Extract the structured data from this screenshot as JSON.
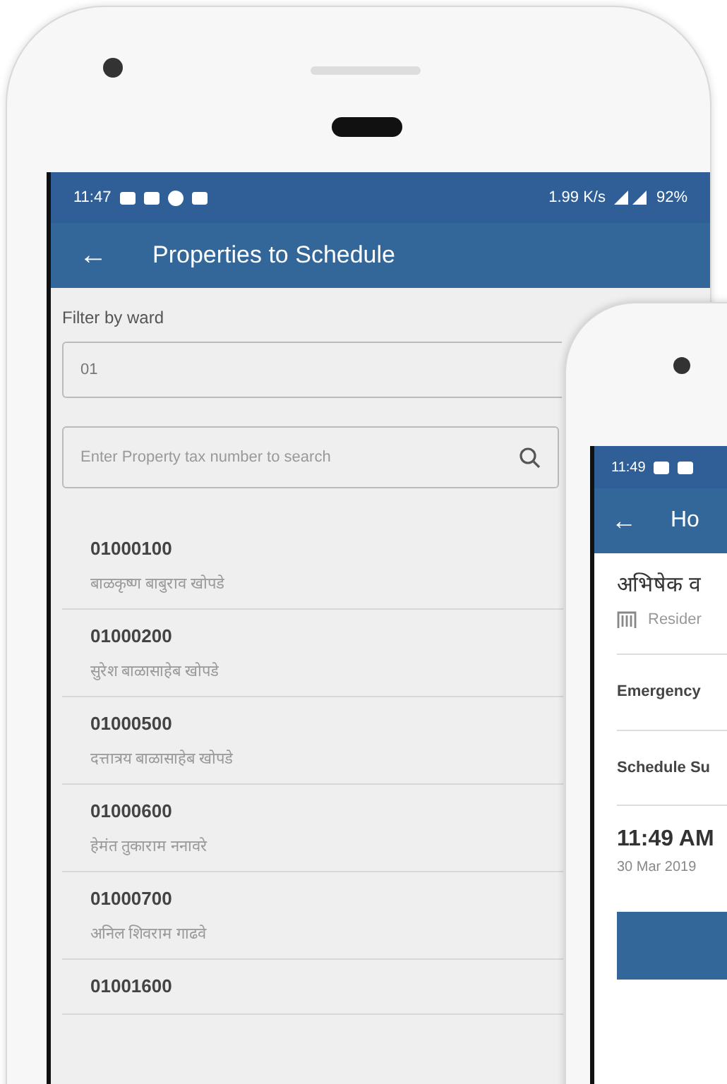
{
  "main_phone": {
    "status_bar": {
      "time": "11:47",
      "speed": "1.99 K/s",
      "battery": "92%"
    },
    "app_bar": {
      "back": "←",
      "title": "Properties to Schedule"
    },
    "filter": {
      "label": "Filter by ward",
      "value": "01"
    },
    "search": {
      "placeholder": "Enter Property tax number to search"
    },
    "properties": [
      {
        "number": "01000100",
        "owner": "बाळकृष्ण बाबुराव खोपडे"
      },
      {
        "number": "01000200",
        "owner": "सुरेश बाळासाहेब खोपडे"
      },
      {
        "number": "01000500",
        "owner": "दत्तात्रय बाळासाहेब खोपडे"
      },
      {
        "number": "01000600",
        "owner": "हेमंत तुकाराम ननावरे"
      },
      {
        "number": "01000700",
        "owner": "अनिल शिवराम गाढवे"
      },
      {
        "number": "01001600"
      }
    ]
  },
  "second_phone": {
    "status_bar": {
      "time": "11:49"
    },
    "app_bar": {
      "back": "←",
      "title": "Ho"
    },
    "name": "अभिषेक व",
    "type": "Resider",
    "rows": [
      "Emergency",
      "Schedule Su"
    ],
    "time": "11:49 AM",
    "date": "30 Mar 2019"
  }
}
